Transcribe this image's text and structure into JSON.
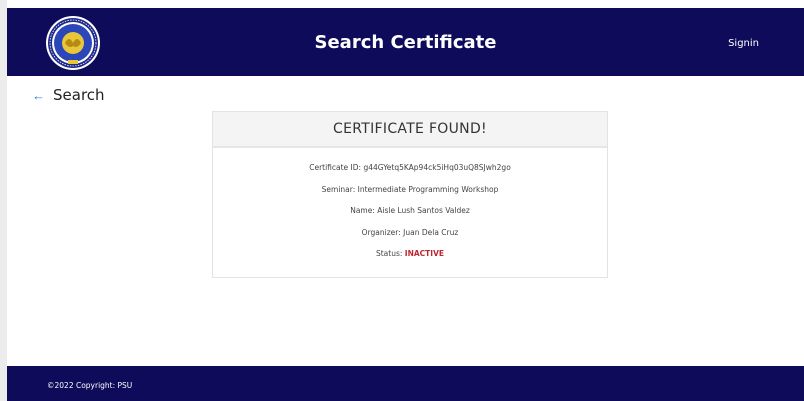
{
  "header": {
    "title": "Search Certificate",
    "signin_label": "Signin",
    "logo_icon": "university-seal-icon"
  },
  "back": {
    "label": "Search",
    "icon": "arrow-left-icon"
  },
  "card": {
    "title": "CERTIFICATE FOUND!",
    "fields": [
      {
        "label": "Certificate ID: ",
        "value": "g44GYetq5KAp94ck5iHq03uQ8SJwh2go"
      },
      {
        "label": "Seminar: ",
        "value": "Intermediate Programming Workshop"
      },
      {
        "label": "Name: ",
        "value": "Aisle Lush Santos Valdez"
      },
      {
        "label": "Organizer: ",
        "value": "Juan Dela Cruz"
      }
    ],
    "status_label": "Status: ",
    "status_value": "INACTIVE"
  },
  "footer": {
    "copyright": "©2022 Copyright: PSU"
  },
  "colors": {
    "navy": "#0d0b5a",
    "status_inactive": "#c0262f",
    "accent_link": "#3b7dd8"
  }
}
